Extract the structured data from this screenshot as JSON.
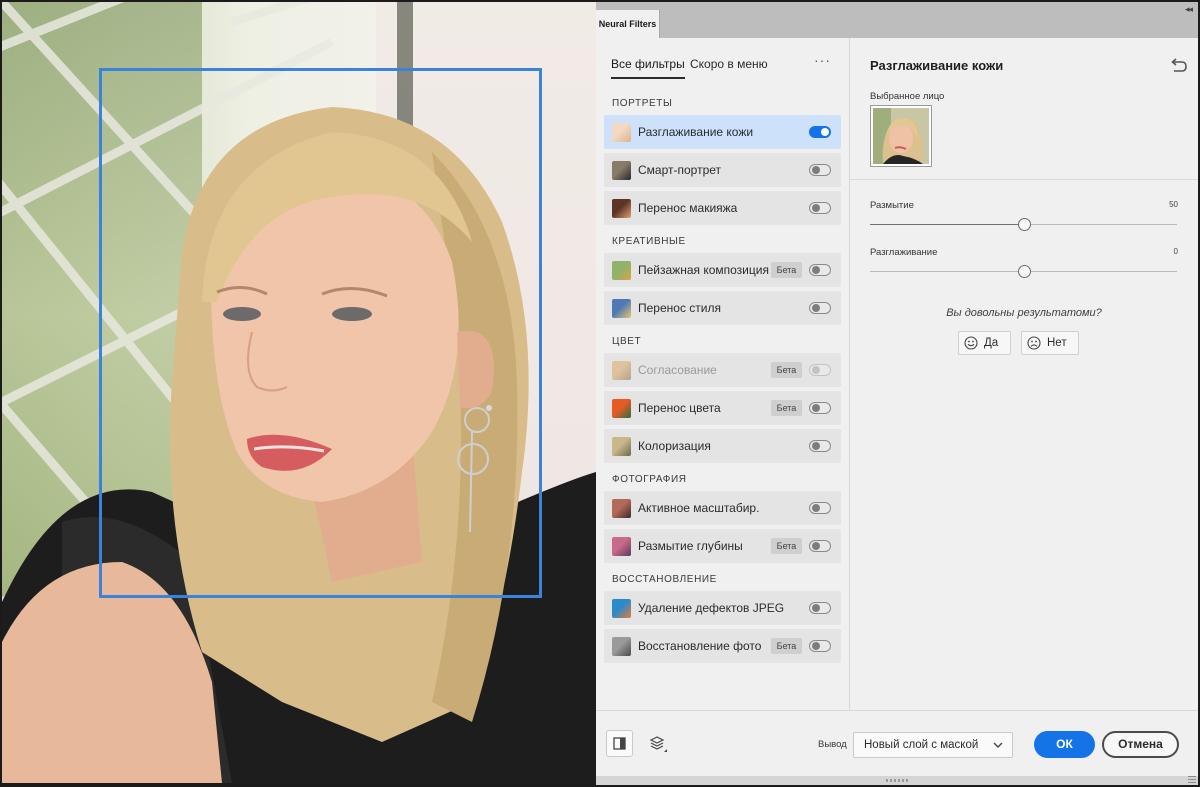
{
  "panel": {
    "tab_title": "Neural Filters",
    "tabs": [
      {
        "label": "Все фильтры",
        "active": true
      },
      {
        "label": "Скоро в меню",
        "active": false
      }
    ],
    "more_label": "···"
  },
  "sections": [
    {
      "label": "ПОРТРЕТЫ",
      "items": [
        {
          "name": "Разглаживание кожи",
          "beta": "",
          "enabled": true,
          "selected": true,
          "disabled": false,
          "icon": "skin-smoothing-thumb"
        },
        {
          "name": "Смарт-портрет",
          "beta": "",
          "enabled": false,
          "selected": false,
          "disabled": false,
          "icon": "smart-portrait-thumb"
        },
        {
          "name": "Перенос макияжа",
          "beta": "",
          "enabled": false,
          "selected": false,
          "disabled": false,
          "icon": "makeup-transfer-thumb"
        }
      ]
    },
    {
      "label": "КРЕАТИВНЫЕ",
      "items": [
        {
          "name": "Пейзажная композиция",
          "beta": "Бета",
          "enabled": false,
          "selected": false,
          "disabled": false,
          "icon": "landscape-mixer-thumb"
        },
        {
          "name": "Перенос стиля",
          "beta": "",
          "enabled": false,
          "selected": false,
          "disabled": false,
          "icon": "style-transfer-thumb"
        }
      ]
    },
    {
      "label": "ЦВЕТ",
      "items": [
        {
          "name": "Согласование",
          "beta": "Бета",
          "enabled": false,
          "selected": false,
          "disabled": true,
          "icon": "harmonization-thumb"
        },
        {
          "name": "Перенос цвета",
          "beta": "Бета",
          "enabled": false,
          "selected": false,
          "disabled": false,
          "icon": "color-transfer-thumb"
        },
        {
          "name": "Колоризация",
          "beta": "",
          "enabled": false,
          "selected": false,
          "disabled": false,
          "icon": "colorize-thumb"
        }
      ]
    },
    {
      "label": "ФОТОГРАФИЯ",
      "items": [
        {
          "name": "Активное масштабир.",
          "beta": "",
          "enabled": false,
          "selected": false,
          "disabled": false,
          "icon": "super-zoom-thumb"
        },
        {
          "name": "Размытие глубины",
          "beta": "Бета",
          "enabled": false,
          "selected": false,
          "disabled": false,
          "icon": "depth-blur-thumb"
        }
      ]
    },
    {
      "label": "ВОССТАНОВЛЕНИЕ",
      "items": [
        {
          "name": "Удаление дефектов JPEG",
          "beta": "",
          "enabled": false,
          "selected": false,
          "disabled": false,
          "icon": "jpeg-artifacts-thumb"
        },
        {
          "name": "Восстановление фото",
          "beta": "Бета",
          "enabled": false,
          "selected": false,
          "disabled": false,
          "icon": "photo-restoration-thumb"
        }
      ]
    }
  ],
  "settings": {
    "title": "Разглаживание кожи",
    "selected_face_label": "Выбранное лицо",
    "sliders": [
      {
        "label": "Размытие",
        "value": 50,
        "min": 0,
        "max": 100
      },
      {
        "label": "Разглаживание",
        "value": 0,
        "min": -50,
        "max": 50
      }
    ],
    "question": "Вы довольны результатоми?",
    "yes_label": "Да",
    "no_label": "Нет"
  },
  "footer": {
    "output_label": "Вывод",
    "output_value": "Новый слой с маской",
    "ok_label": "ОК",
    "cancel_label": "Отмена"
  },
  "colors": {
    "accent": "#1473e6",
    "face_box": "#3b82db",
    "selected_row": "#cde1fb"
  }
}
